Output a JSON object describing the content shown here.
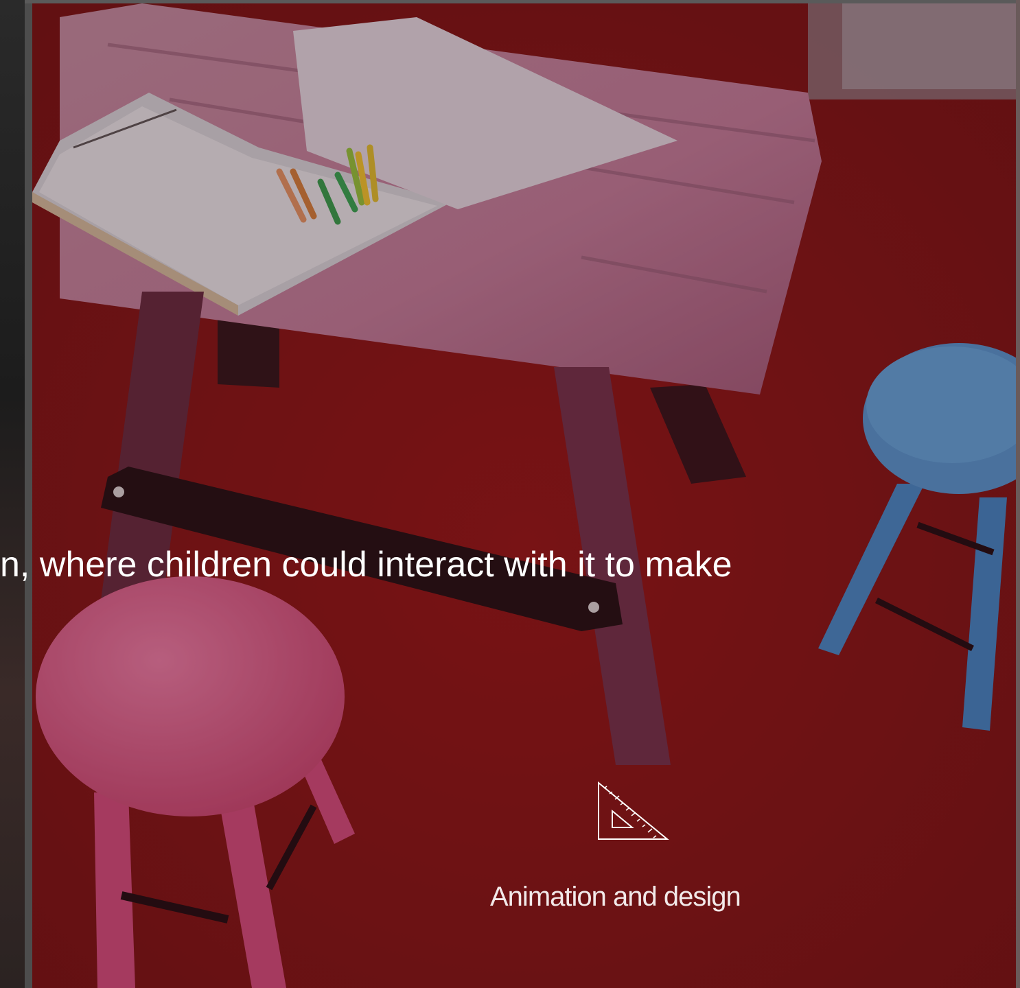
{
  "slide": {
    "body_text": "n, where children could interact with it to make",
    "caption": "Animation and design",
    "caption_icon": "set-square-icon",
    "photo_subject": "pink play table with drawing board and stools"
  },
  "colors": {
    "floor_red": "#7e1414",
    "text": "#ffffff",
    "table_pink": "#c6708e",
    "stool_blue": "#4a8fc8"
  }
}
